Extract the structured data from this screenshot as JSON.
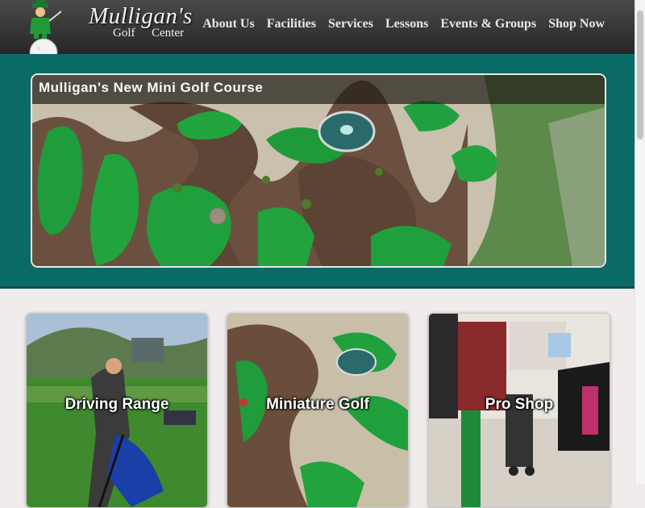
{
  "header": {
    "logo_title": "Mulligan's",
    "logo_word_1": "Golf",
    "logo_word_2": "Center",
    "nav": [
      "About Us",
      "Facilities",
      "Services",
      "Lessons",
      "Events & Groups",
      "Shop Now"
    ]
  },
  "hero": {
    "title": "Mulligan's New Mini Golf Course"
  },
  "cards": [
    {
      "label": "Driving Range"
    },
    {
      "label": "Miniature Golf"
    },
    {
      "label": "Pro Shop"
    }
  ],
  "colors": {
    "header_bg": "#333333",
    "hero_bg": "#0a6b66",
    "page_bg": "#f0ecec",
    "turf": "#1e9c3a"
  }
}
